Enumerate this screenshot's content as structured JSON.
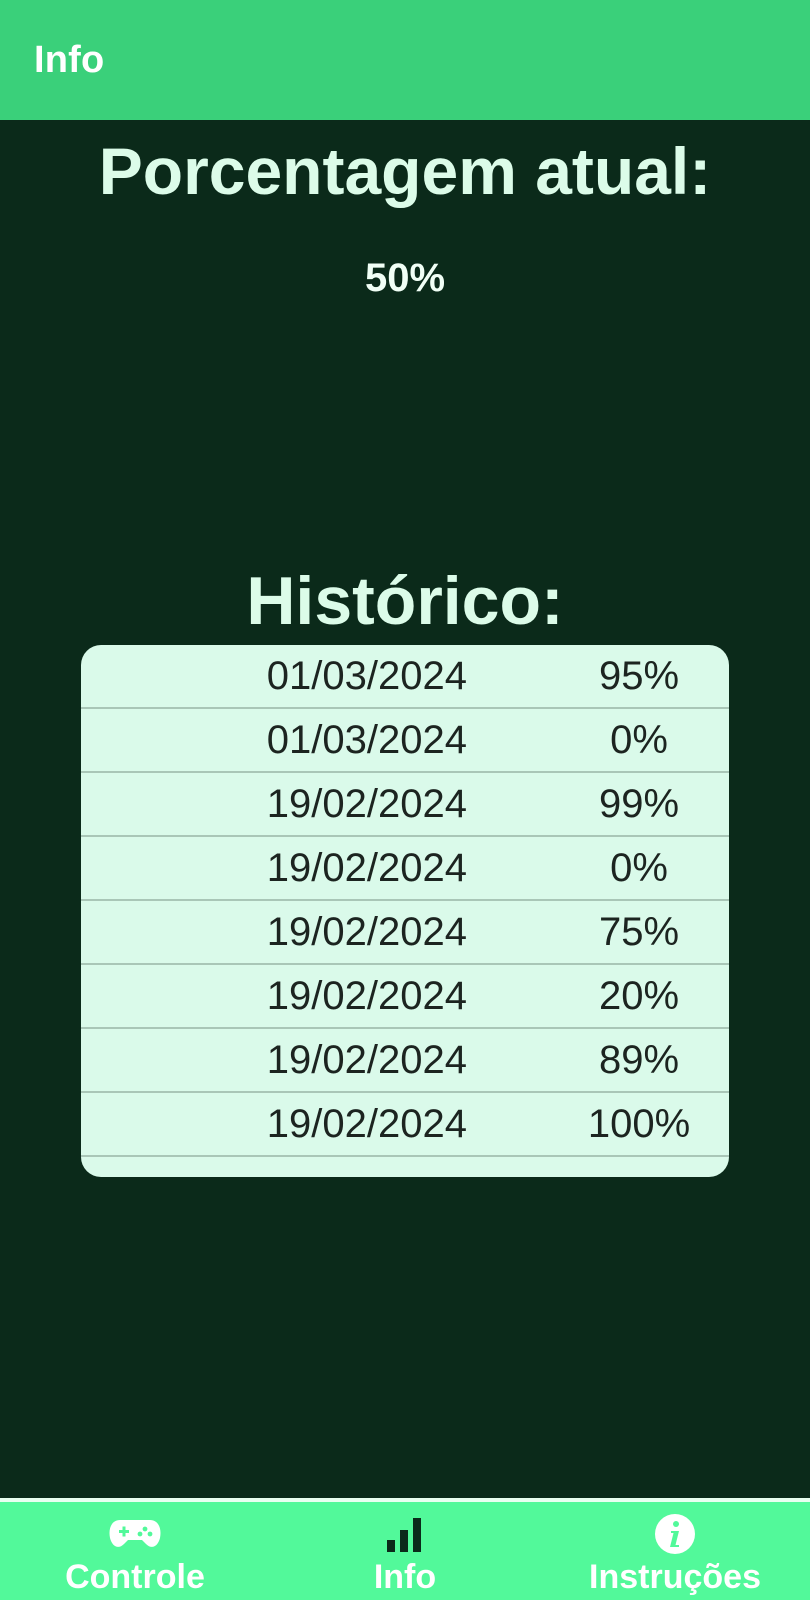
{
  "header": {
    "title": "Info"
  },
  "current": {
    "title": "Porcentagem atual:",
    "value": "50%"
  },
  "history": {
    "title": "Histórico:",
    "rows": [
      {
        "date": "01/03/2024",
        "percent": "95%"
      },
      {
        "date": "01/03/2024",
        "percent": "0%"
      },
      {
        "date": "19/02/2024",
        "percent": "99%"
      },
      {
        "date": "19/02/2024",
        "percent": "0%"
      },
      {
        "date": "19/02/2024",
        "percent": "75%"
      },
      {
        "date": "19/02/2024",
        "percent": "20%"
      },
      {
        "date": "19/02/2024",
        "percent": "89%"
      },
      {
        "date": "19/02/2024",
        "percent": "100%"
      }
    ]
  },
  "bottom_nav": {
    "items": [
      {
        "label": "Controle",
        "icon": "gamepad-icon"
      },
      {
        "label": "Info",
        "icon": "signal-bars-icon"
      },
      {
        "label": "Instruções",
        "icon": "info-circle-icon"
      }
    ]
  },
  "colors": {
    "appbar": "#3ad07a",
    "background": "#0b2a1a",
    "card": "#dafaea",
    "bottom_nav": "#52f99a"
  }
}
